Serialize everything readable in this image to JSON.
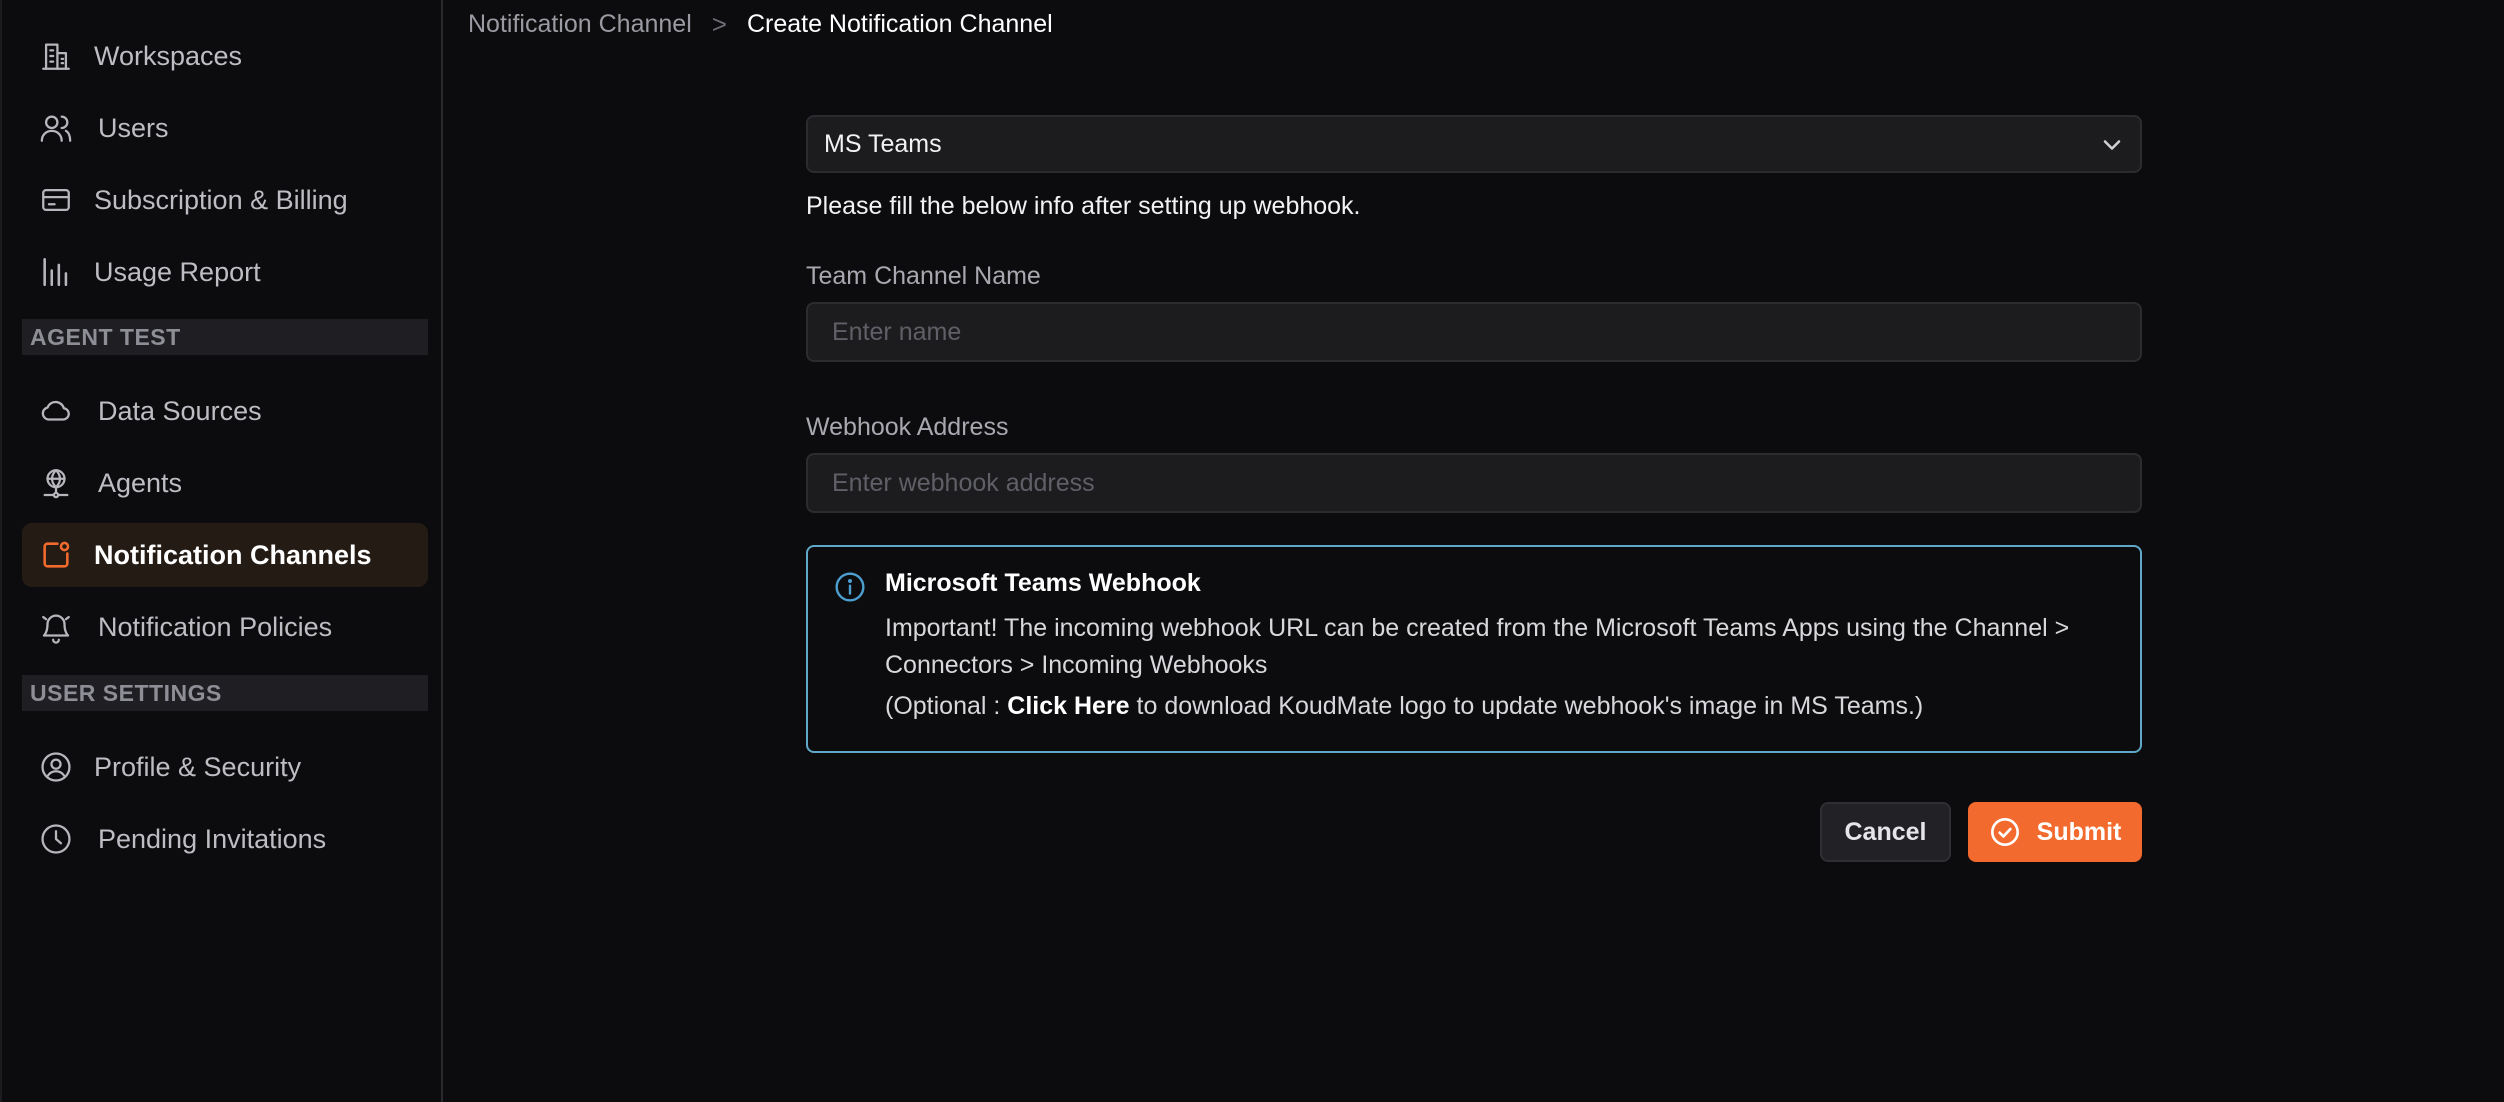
{
  "sidebar": {
    "items": [
      {
        "label": "Workspaces",
        "icon": "building-icon"
      },
      {
        "label": "Users",
        "icon": "users-icon"
      },
      {
        "label": "Subscription & Billing",
        "icon": "credit-card-icon"
      },
      {
        "label": "Usage Report",
        "icon": "bar-chart-icon"
      },
      {
        "label": "Data Sources",
        "icon": "cloud-icon"
      },
      {
        "label": "Agents",
        "icon": "globe-network-icon"
      },
      {
        "label": "Notification Channels",
        "icon": "notification-square-icon",
        "active": true
      },
      {
        "label": "Notification Policies",
        "icon": "bell-alert-icon"
      },
      {
        "label": "Profile & Security",
        "icon": "user-circle-icon"
      },
      {
        "label": "Pending Invitations",
        "icon": "clock-icon"
      }
    ],
    "sections": {
      "agent": "AGENT TEST",
      "user": "USER SETTINGS"
    }
  },
  "breadcrumb": {
    "parent": "Notification Channel",
    "separator": ">",
    "current": "Create Notification Channel"
  },
  "form": {
    "channel_type": "MS Teams",
    "helper": "Please fill the below info after setting up webhook.",
    "team_channel_label": "Team Channel Name",
    "team_channel_placeholder": "Enter name",
    "team_channel_value": "",
    "webhook_label": "Webhook Address",
    "webhook_placeholder": "Enter webhook address",
    "webhook_value": ""
  },
  "info": {
    "title": "Microsoft Teams Webhook",
    "body": "Important! The incoming webhook URL can be created from the Microsoft Teams Apps using the Channel > Connectors > Incoming Webhooks",
    "optional_prefix": "(Optional : ",
    "optional_link": "Click Here",
    "optional_suffix": " to download KoudMate logo to update webhook's image in MS Teams.)"
  },
  "buttons": {
    "cancel": "Cancel",
    "submit": "Submit"
  },
  "colors": {
    "accent": "#f26a2e",
    "info_border": "#5fa8c8",
    "active_bg": "#241b15"
  }
}
